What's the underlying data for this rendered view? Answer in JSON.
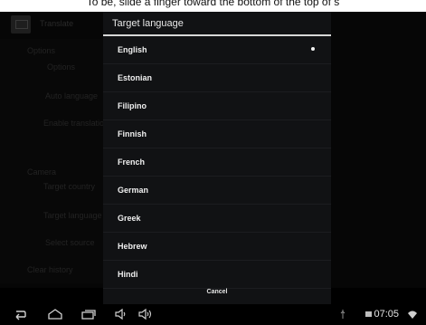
{
  "banner": {
    "text": "To be, slide a finger toward the bottom of the top of s"
  },
  "background_app": {
    "title": "Translate",
    "items": [
      "Options",
      "Auto language",
      "Enable translation",
      "Camera",
      "Target country",
      "Target language",
      "Select source",
      "Clear history"
    ]
  },
  "dialog": {
    "title": "Target language",
    "options": [
      {
        "label": "English",
        "selected": true
      },
      {
        "label": "Estonian",
        "selected": false
      },
      {
        "label": "Filipino",
        "selected": false
      },
      {
        "label": "Finnish",
        "selected": false
      },
      {
        "label": "French",
        "selected": false
      },
      {
        "label": "German",
        "selected": false
      },
      {
        "label": "Greek",
        "selected": false
      },
      {
        "label": "Hebrew",
        "selected": false
      },
      {
        "label": "Hindi",
        "selected": false
      }
    ],
    "cancel_label": "Cancel"
  },
  "navbar": {
    "icons": [
      "back-icon",
      "home-icon",
      "recent-apps-icon",
      "volume-down-icon",
      "volume-up-icon"
    ],
    "status_icons": [
      "usb-icon",
      "battery-icon",
      "wifi-icon"
    ],
    "time": "07:05"
  },
  "colors": {
    "dialog_bg": "#111214",
    "accent_line": "#d7d7d7",
    "text": "#f0f0f0"
  }
}
